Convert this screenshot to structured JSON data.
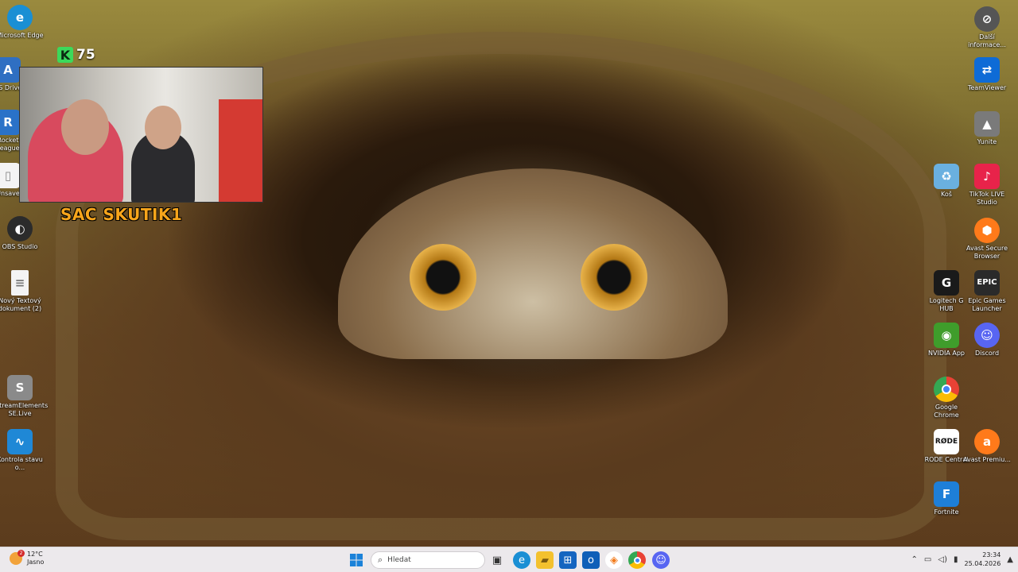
{
  "desktop": {
    "left_icons": [
      {
        "label": "Microsoft Edge",
        "icon": "edge-icon",
        "color": "#1a8fd4"
      },
      {
        "label": "AS Drive",
        "icon": "drive-icon",
        "color": "#2f6fc2"
      },
      {
        "label": "Rocket League",
        "icon": "rocket-league-icon",
        "color": "#2a72c8"
      },
      {
        "label": "Unsave",
        "icon": "file-icon",
        "color": "#f4f4f4"
      },
      {
        "label": "OBS Studio",
        "icon": "obs-icon",
        "color": "#2b2b2b"
      },
      {
        "label": "Nový Textový dokument (2)",
        "icon": "text-file-icon",
        "color": "#f4f4f4"
      },
      {
        "label": "StreamElements SE.Live",
        "icon": "streamelements-icon",
        "color": "#8a8a8a"
      },
      {
        "label": "Kontrola stavu o...",
        "icon": "pc-health-icon",
        "color": "#1f88d6"
      }
    ],
    "right_icons": [
      {
        "label": "Další informace...",
        "icon": "info-icon",
        "color": "#555555"
      },
      {
        "label": "TeamViewer",
        "icon": "teamviewer-icon",
        "color": "#0e6bd6"
      },
      {
        "label": "Yunite",
        "icon": "yunite-icon",
        "color": "#7a7a7a"
      },
      {
        "label": "Koš",
        "icon": "recycle-bin-icon",
        "color": "#6ab0e0"
      },
      {
        "label": "TikTok LIVE Studio",
        "icon": "tiktok-icon",
        "color": "#e8234a"
      },
      {
        "label": "Avast Secure Browser",
        "icon": "avast-browser-icon",
        "color": "#ff7a1a"
      },
      {
        "label": "Logitech G HUB",
        "icon": "logitech-icon",
        "color": "#1a1a1a"
      },
      {
        "label": "Epic Games Launcher",
        "icon": "epic-games-icon",
        "color": "#2a2a2a"
      },
      {
        "label": "NVIDIA App",
        "icon": "nvidia-icon",
        "color": "#3f9d2b"
      },
      {
        "label": "Discord",
        "icon": "discord-icon",
        "color": "#5865f2"
      },
      {
        "label": "Google Chrome",
        "icon": "chrome-icon",
        "color": "#e94235"
      },
      {
        "label": "RODE Central",
        "icon": "rode-icon",
        "color": "#ffffff"
      },
      {
        "label": "Avast Premiu...",
        "icon": "avast-icon",
        "color": "#ff7a1a"
      },
      {
        "label": "Fortnite",
        "icon": "fortnite-icon",
        "color": "#1e7fd8"
      }
    ]
  },
  "overlay": {
    "k_letter": "K",
    "k_count": "75",
    "streamer_name": "SAC SKUTIK1"
  },
  "taskbar": {
    "weather_temp": "12°C",
    "weather_desc": "Jasno",
    "weather_badge": "2",
    "search_placeholder": "Hledat",
    "time": "23:34",
    "date": "25.04.2026"
  }
}
